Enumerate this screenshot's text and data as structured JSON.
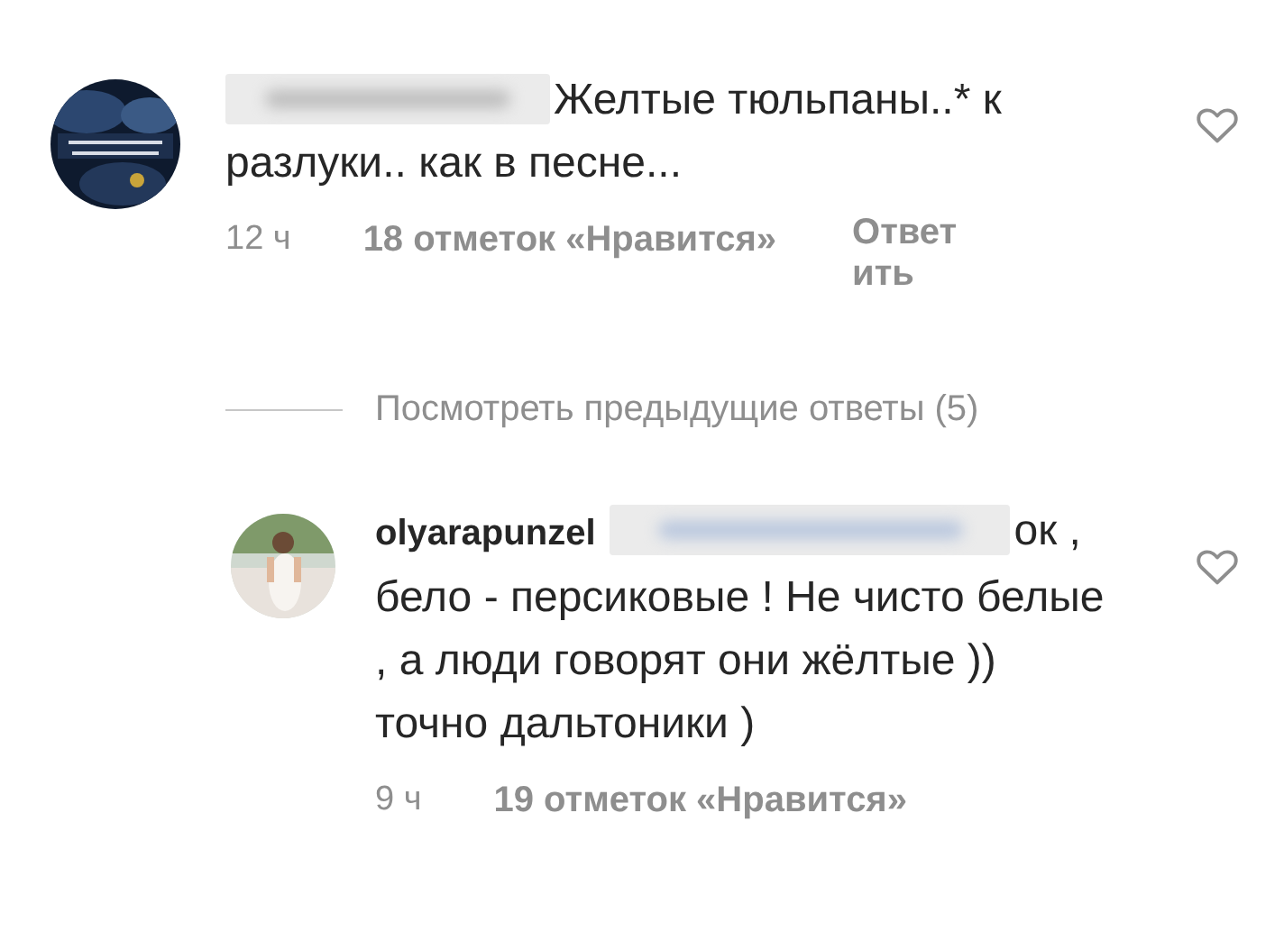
{
  "comments": [
    {
      "kind": "top",
      "author_blurred": true,
      "text": "Желтые тюльпаны..* к разлуки.. как в песне...",
      "liked": false,
      "time": "12 ч",
      "likes": "18 отметок «Нравится»",
      "reply": "Ответить"
    },
    {
      "kind": "thread",
      "label": "Посмотреть предыдущие ответы (5)"
    },
    {
      "kind": "reply",
      "author": "olyarapunzel",
      "mention_blurred": true,
      "text": "ок , бело - персиковые ! Не чисто белые , а люди говорят они жёлтые )) точно дальтоники )",
      "liked": false,
      "time": "9 ч",
      "likes": "19 отметок «Нравится»"
    }
  ]
}
